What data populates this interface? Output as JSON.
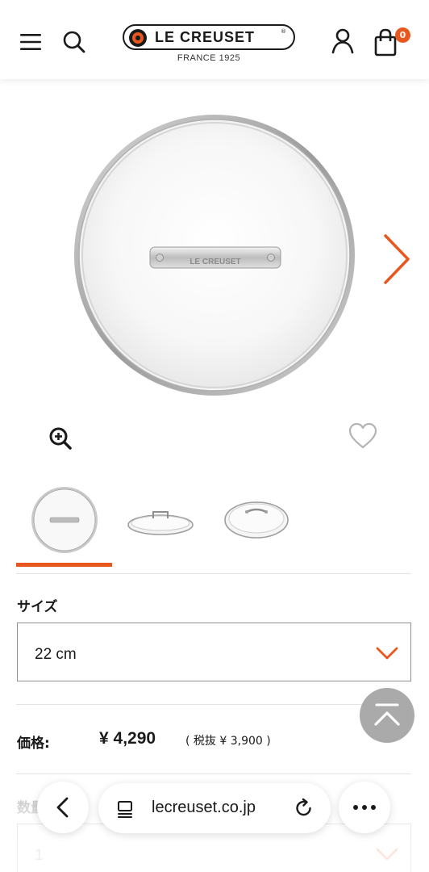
{
  "header": {
    "brand": "LE CREUSET",
    "brand_mark": "®",
    "brand_sub": "FRANCE 1925",
    "cart_count": "0",
    "icons": {
      "menu": "menu-icon",
      "search": "search-icon",
      "account": "account-icon",
      "cart": "cart-icon"
    }
  },
  "product": {
    "handle_engraving": "LE CREUSET",
    "thumbnails": [
      "lid-top-view",
      "lid-side-view",
      "lid-angle-view"
    ],
    "active_thumbnail": 0
  },
  "options": {
    "size_label": "サイズ",
    "size_value": "22 cm",
    "price_label": "価格:",
    "price_value": "¥ 4,290",
    "price_tax": "( 税抜 ¥ 3,900 )",
    "qty_label": "数量",
    "qty_value": "1"
  },
  "browser": {
    "url": "lecreuset.co.jp"
  },
  "colors": {
    "accent": "#e8581e",
    "text": "#1a1a1a",
    "back_to_top": "#a6a6a6"
  }
}
